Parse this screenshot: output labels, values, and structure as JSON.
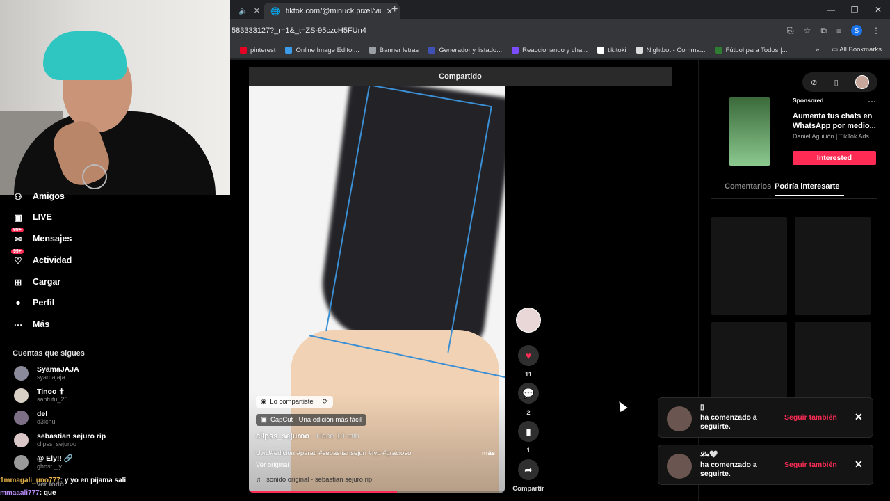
{
  "browser": {
    "active_tab_title": "tiktok.com/@minuck.pixel/vide",
    "url": "583333127?_r=1&_t=ZS-95czcH5FUn4",
    "bookmarks": [
      {
        "label": "pinterest",
        "color": "#e60023"
      },
      {
        "label": "Online Image Editor...",
        "color": "#3b9be8"
      },
      {
        "label": "Banner letras",
        "color": "#9aa0a6"
      },
      {
        "label": "Generador y listado...",
        "color": "#3f51b5"
      },
      {
        "label": "Reaccionando y cha...",
        "color": "#7c4dff"
      },
      {
        "label": "tikitoki",
        "color": "#ffffff"
      },
      {
        "label": "Nightbot - Comma...",
        "color": "#dddddd"
      },
      {
        "label": "Fútbol para Todos |...",
        "color": "#2e7d32"
      }
    ],
    "bookmarks_overflow": "»",
    "all_bookmarks": "All Bookmarks",
    "profile_initial": "S"
  },
  "sidebar": {
    "nav": [
      {
        "label": "Amigos",
        "icon": "friends-icon"
      },
      {
        "label": "LIVE",
        "icon": "live-icon"
      },
      {
        "label": "Mensajes",
        "icon": "messages-icon",
        "badge": "99+"
      },
      {
        "label": "Actividad",
        "icon": "activity-icon",
        "badge": "99+"
      },
      {
        "label": "Cargar",
        "icon": "upload-icon"
      },
      {
        "label": "Perfil",
        "icon": "profile-icon"
      },
      {
        "label": "Más",
        "icon": "more-icon"
      }
    ],
    "following_title": "Cuentas que sigues",
    "following": [
      {
        "name": "SyamaJAJA",
        "handle": "syamajaja"
      },
      {
        "name": "Tinoo ✝",
        "handle": "santutu_26"
      },
      {
        "name": "del",
        "handle": "d3lchu"
      },
      {
        "name": "sebastian sejuro rip",
        "handle": "clipss_sejuroo"
      },
      {
        "name": "@ Ely!! 🔗",
        "handle": "ghost._ly"
      }
    ],
    "see_all": "Ver todo"
  },
  "chat": [
    {
      "user": "1mmagali_uno777",
      "text": ": y yo en pijama salí"
    },
    {
      "user": "mmaaali777",
      "text": ": que"
    }
  ],
  "video": {
    "shared_label": "Compartido",
    "shared_chip": "Lo compartiste",
    "capcut_chip": "CapCut · Una edición más fácil",
    "author": "clipss_sejuroo",
    "time": " · Hace 10 min",
    "description": "UwU#edicion #parati #sebastiansejuri #fyp #gracioso",
    "more": "más",
    "original": "Ver original",
    "sound": "sonido original - sebastian sejuro rip",
    "progress": 0.58,
    "likes": "11",
    "comments": "2",
    "saves": "1",
    "share_label": "Compartir"
  },
  "right_panel": {
    "sponsored": "Sponsored",
    "ad_title": "Aumenta tus chats en WhatsApp por medio...",
    "ad_author": "Daniel Aguilión | TikTok Ads",
    "ad_button": "Interested",
    "tab_comments": "Comentarios",
    "tab_suggested": "Podría interesarte"
  },
  "notifications": [
    {
      "name": "▯",
      "message": "ha comenzado a seguirte.",
      "action": "Seguir también"
    },
    {
      "name": "𝓛𝓾🤍",
      "message": "ha comenzado a seguirte.",
      "action": "Seguir también"
    }
  ],
  "colors": {
    "accent": "#fe2c55",
    "panel": "#141414"
  }
}
